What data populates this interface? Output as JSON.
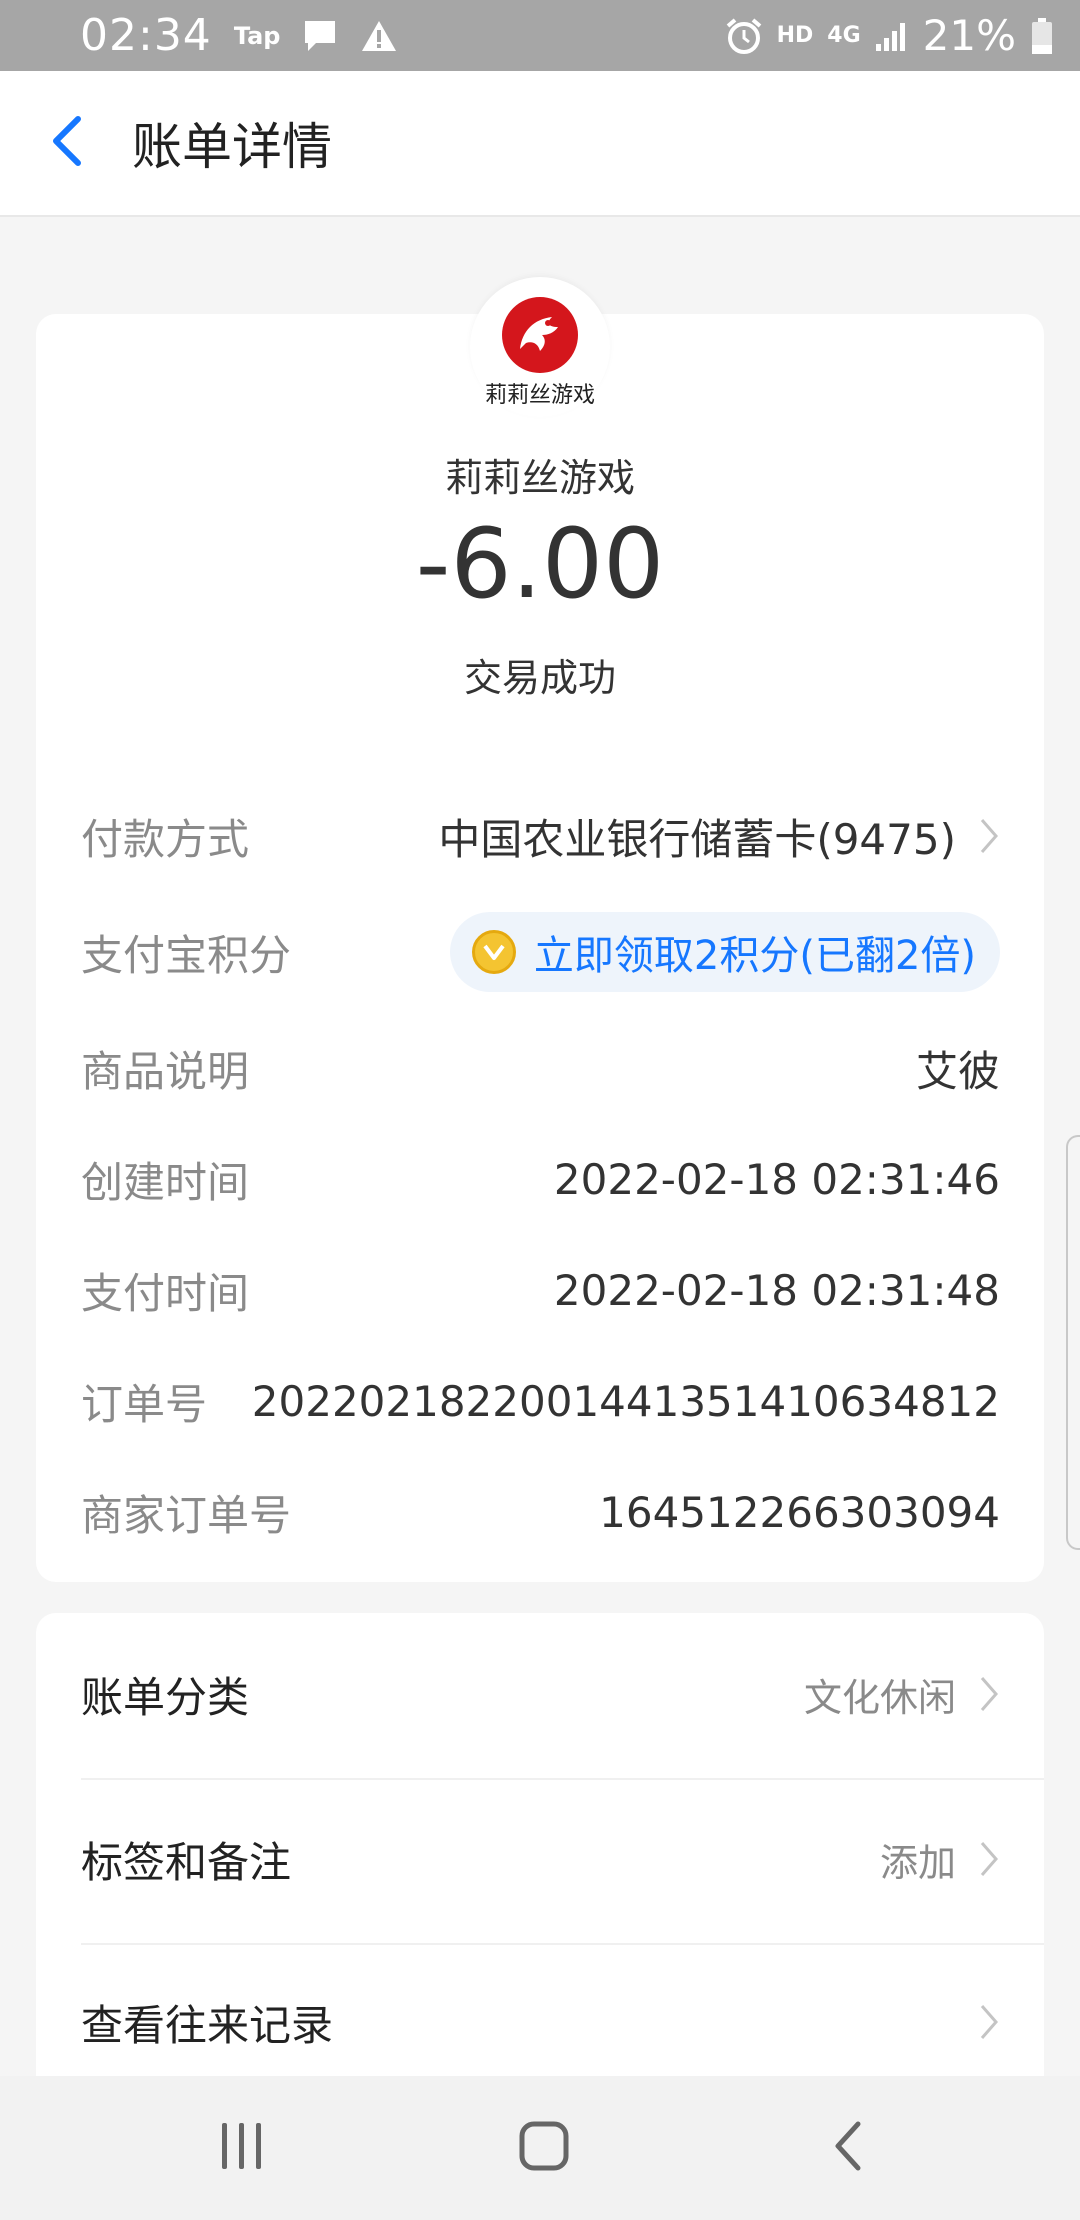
{
  "status_bar": {
    "time": "02:34",
    "tap_label": "Tap",
    "hd_label": "HD",
    "network_label": "4G",
    "battery_percent": "21%",
    "icons": [
      "message-icon",
      "warning-icon",
      "alarm-icon",
      "signal-icon",
      "battery-icon"
    ]
  },
  "nav": {
    "title": "账单详情",
    "back_icon": "chevron-left-icon"
  },
  "merchant": {
    "logo_text": "莉莉丝游戏",
    "name": "莉莉丝游戏",
    "amount": "-6.00",
    "status": "交易成功"
  },
  "details": {
    "payment_method": {
      "label": "付款方式",
      "value": "中国农业银行储蓄卡(9475)"
    },
    "points": {
      "label": "支付宝积分",
      "value": "立即领取2积分(已翻2倍)"
    },
    "product": {
      "label": "商品说明",
      "value": "艾彼"
    },
    "created_time": {
      "label": "创建时间",
      "value": "2022-02-18 02:31:46"
    },
    "paid_time": {
      "label": "支付时间",
      "value": "2022-02-18 02:31:48"
    },
    "order_no": {
      "label": "订单号",
      "value": "2022021822001441351410634812"
    },
    "merchant_order_no": {
      "label": "商家订单号",
      "value": "164512266303094"
    }
  },
  "menu": {
    "category": {
      "label": "账单分类",
      "value": "文化休闲"
    },
    "tags": {
      "label": "标签和备注",
      "value": "添加"
    },
    "history": {
      "label": "查看往来记录"
    }
  },
  "colors": {
    "accent": "#1677ff",
    "status_bar": "#a6a6a6",
    "logo_red": "#d4161c"
  }
}
